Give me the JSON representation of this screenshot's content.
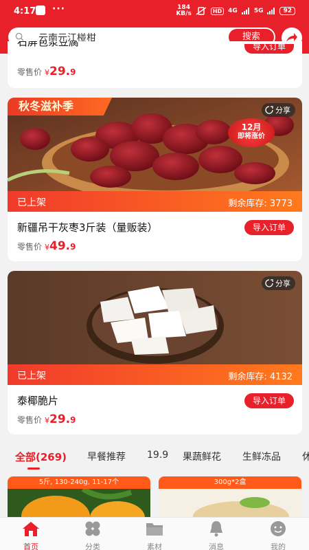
{
  "status_bar": {
    "time": "4:17",
    "dots": "···",
    "net_speed_top": "184",
    "net_speed_bottom": "KB/s",
    "hd": "HD",
    "sig1": "4G",
    "sig2": "5G",
    "battery": "92"
  },
  "search": {
    "placeholder": "云南元江椪柑",
    "button": "搜索"
  },
  "products": [
    {
      "name": "石屏包浆豆腐",
      "price_label": "零售价",
      "currency": "¥",
      "price_int": "29.",
      "price_dec": "9",
      "order_button": "导入订单"
    },
    {
      "name": "新疆吊干灰枣3斤装（量贩装）",
      "promo": "秋冬滋补季",
      "badge_line1": "12月",
      "badge_line2": "即将涨价",
      "share": "分享",
      "status": "已上架",
      "stock_label": "剩余库存:",
      "stock": "3773",
      "price_label": "零售价",
      "currency": "¥",
      "price_int": "49.",
      "price_dec": "9",
      "order_button": "导入订单"
    },
    {
      "name": "泰椰脆片",
      "share": "分享",
      "status": "已上架",
      "stock_label": "剩余库存:",
      "stock": "4132",
      "price_label": "零售价",
      "currency": "¥",
      "price_int": "29.",
      "price_dec": "9",
      "order_button": "导入订单"
    }
  ],
  "tabs": [
    {
      "label": "全部(269)"
    },
    {
      "label": "早餐推荐"
    },
    {
      "label": "19.9"
    },
    {
      "label": "果蔬鲜花"
    },
    {
      "label": "生鲜冻品"
    },
    {
      "label": "休"
    }
  ],
  "previews": [
    {
      "label": "5斤, 130-240g, 11-17个"
    },
    {
      "label": "300g*2盒"
    }
  ],
  "nav": [
    {
      "label": "首页"
    },
    {
      "label": "分类"
    },
    {
      "label": "素材"
    },
    {
      "label": "消息"
    },
    {
      "label": "我的"
    }
  ],
  "colors": {
    "accent": "#e8202a",
    "orange": "#ff7a1c"
  }
}
